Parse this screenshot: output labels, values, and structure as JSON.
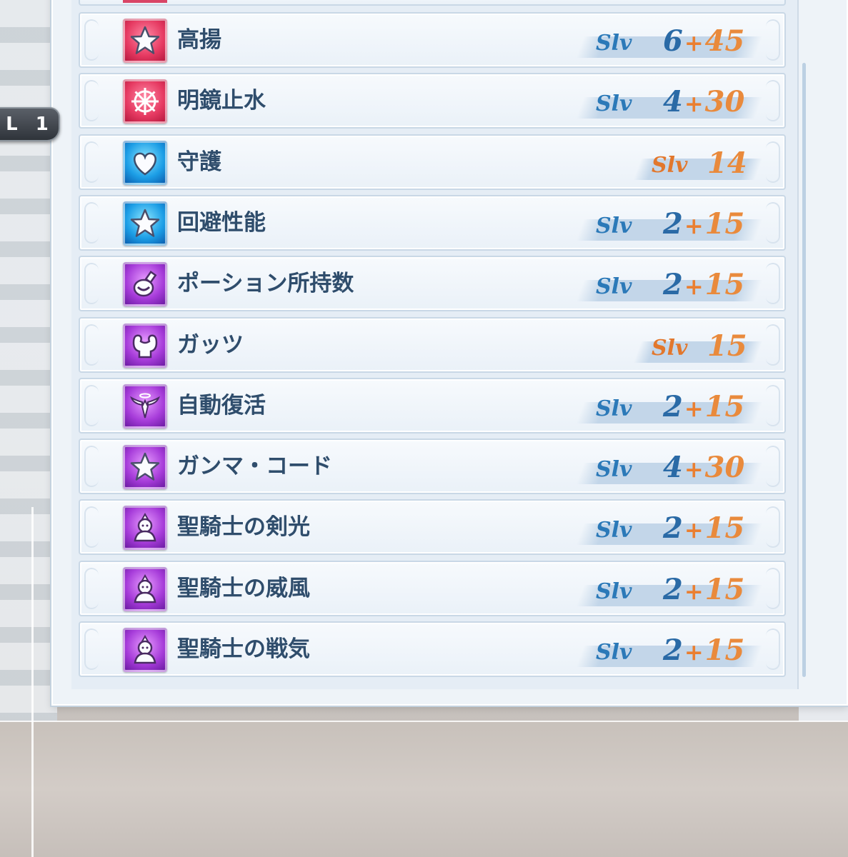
{
  "controller": {
    "l1_label": "L 1"
  },
  "skills": [
    {
      "name": "高揚",
      "icon": "star-icon",
      "color": "red",
      "slv_label": "Slv",
      "base": "6",
      "plus": "+",
      "bonus": "45",
      "type": "split"
    },
    {
      "name": "明鏡止水",
      "icon": "wheel-icon",
      "color": "red",
      "slv_label": "Slv",
      "base": "4",
      "plus": "+",
      "bonus": "30",
      "type": "split"
    },
    {
      "name": "守護",
      "icon": "heart-icon",
      "color": "blue",
      "slv_label": "Slv",
      "level": "14",
      "type": "single"
    },
    {
      "name": "回避性能",
      "icon": "star-icon",
      "color": "blue",
      "slv_label": "Slv",
      "base": "2",
      "plus": "+",
      "bonus": "15",
      "type": "split"
    },
    {
      "name": "ポーション所持数",
      "icon": "potion-icon",
      "color": "purple",
      "slv_label": "Slv",
      "base": "2",
      "plus": "+",
      "bonus": "15",
      "type": "split"
    },
    {
      "name": "ガッツ",
      "icon": "muscle-icon",
      "color": "purple",
      "slv_label": "Slv",
      "level": "15",
      "type": "single"
    },
    {
      "name": "自動復活",
      "icon": "angel-icon",
      "color": "purple",
      "slv_label": "Slv",
      "base": "2",
      "plus": "+",
      "bonus": "15",
      "type": "split"
    },
    {
      "name": "ガンマ・コード",
      "icon": "star-icon",
      "color": "purple",
      "slv_label": "Slv",
      "base": "4",
      "plus": "+",
      "bonus": "30",
      "type": "split"
    },
    {
      "name": "聖騎士の剣光",
      "icon": "knight-icon",
      "color": "purple",
      "slv_label": "Slv",
      "base": "2",
      "plus": "+",
      "bonus": "15",
      "type": "split"
    },
    {
      "name": "聖騎士の威風",
      "icon": "knight-icon",
      "color": "purple",
      "slv_label": "Slv",
      "base": "2",
      "plus": "+",
      "bonus": "15",
      "type": "split"
    },
    {
      "name": "聖騎士の戦気",
      "icon": "knight-icon",
      "color": "purple",
      "slv_label": "Slv",
      "base": "2",
      "plus": "+",
      "bonus": "15",
      "type": "split"
    }
  ]
}
